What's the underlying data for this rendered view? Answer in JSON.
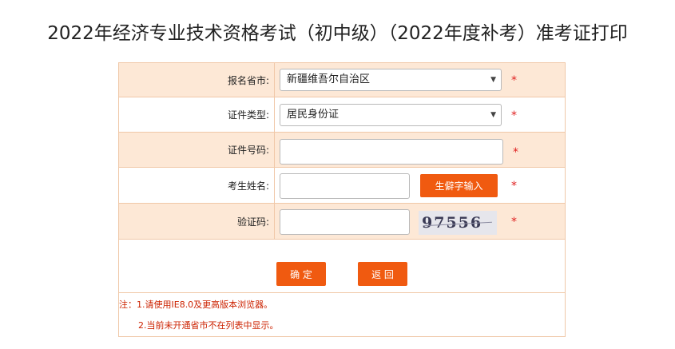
{
  "page": {
    "title": "2022年经济专业技术资格考试（初中级）（2022年度补考）准考证打印"
  },
  "form": {
    "province": {
      "label": "报名省市:",
      "value": "新疆维吾尔自治区"
    },
    "id_type": {
      "label": "证件类型:",
      "value": "居民身份证"
    },
    "id_number": {
      "label": "证件号码:",
      "value": "",
      "placeholder": ""
    },
    "name": {
      "label": "考生姓名:",
      "value": "",
      "rare_char_button": "生僻字输入"
    },
    "captcha": {
      "label": "验证码:",
      "value": "",
      "image_text": "97556"
    },
    "required_mark": "*"
  },
  "actions": {
    "confirm_label": "确 定",
    "back_label": "返 回"
  },
  "notes": {
    "line1": "注：1.请使用IE8.0及更高版本浏览器。",
    "line2": "2.当前未开通省市不在列表中显示。"
  },
  "colors": {
    "accent": "#f05a10",
    "row_alt": "#fde8d6",
    "border": "#f0c8a8",
    "required": "#e02020"
  }
}
